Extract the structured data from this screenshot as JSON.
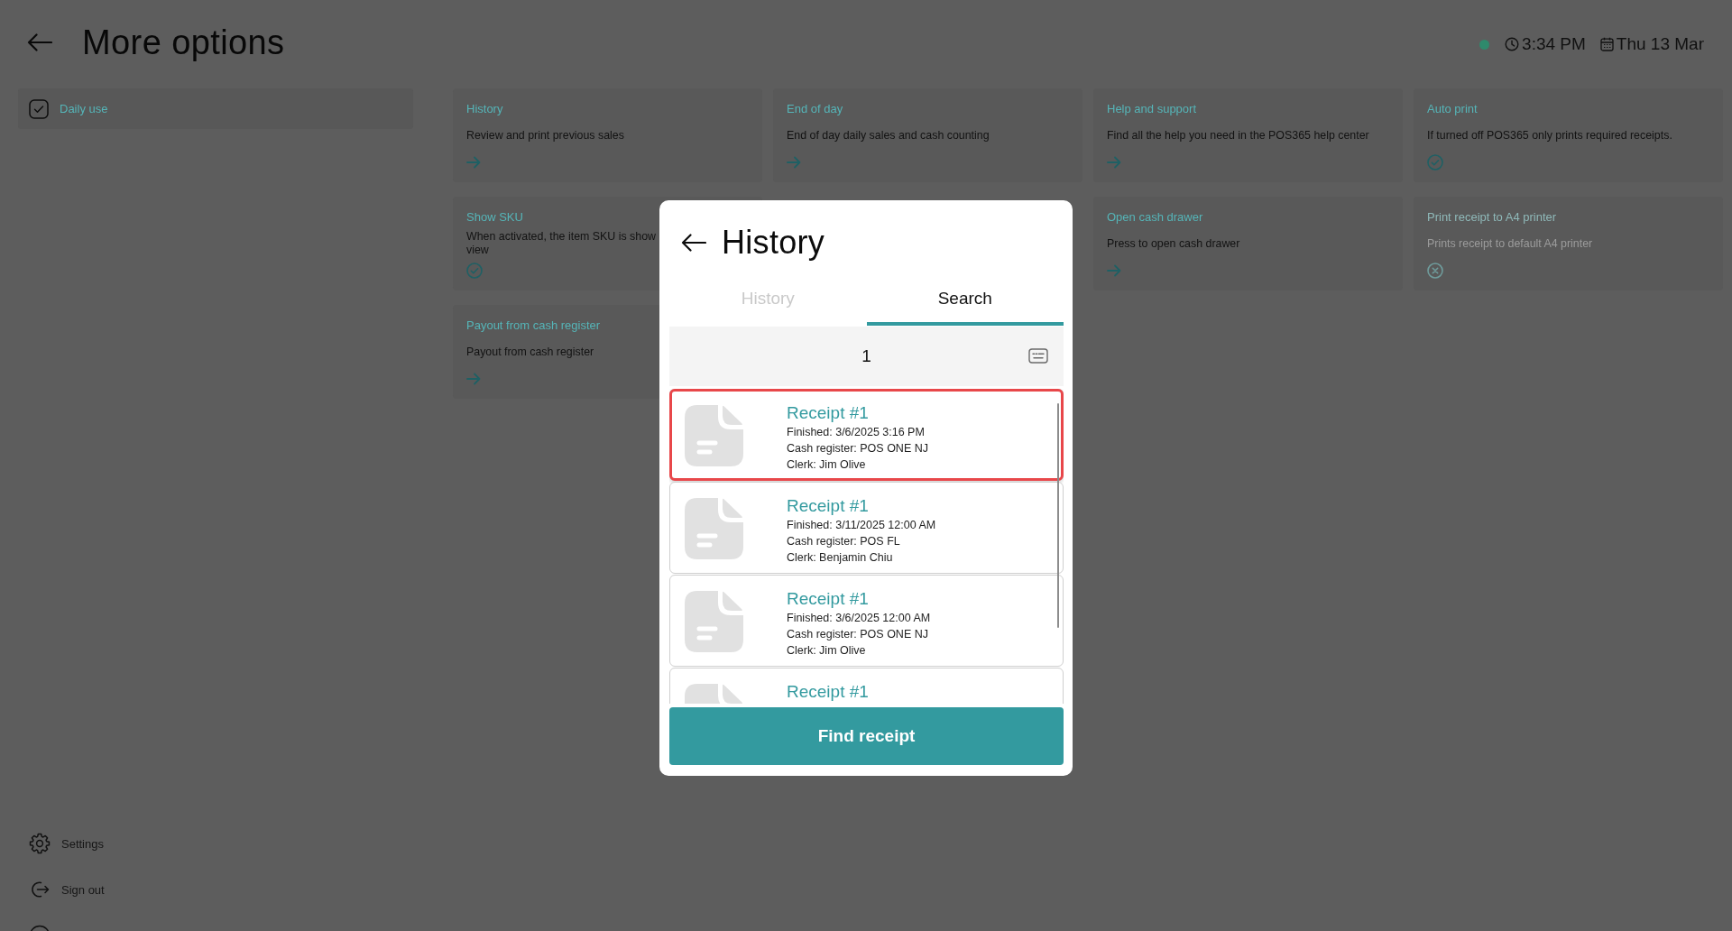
{
  "header": {
    "title": "More options"
  },
  "status": {
    "online": true,
    "time": "3:34 PM",
    "date": "Thu 13 Mar"
  },
  "sidebar": {
    "items": [
      {
        "label": "Daily use",
        "selected": true
      }
    ],
    "footer_items": [
      {
        "kind": "settings",
        "label": "Settings"
      },
      {
        "kind": "signout",
        "label": "Sign out"
      },
      {
        "kind": "other"
      }
    ]
  },
  "option_grid": {
    "columns": [
      {
        "cards": [
          {
            "kind": "link",
            "title": "History",
            "description": "Review and print previous sales",
            "disabled": false
          },
          {
            "kind": "toggle",
            "title": "Show SKU",
            "description": "When activated, the item SKU is show\nview",
            "on": true,
            "disabled": false
          },
          {
            "kind": "link",
            "title": "Payout from cash register",
            "description": "Payout from cash register",
            "disabled": false
          }
        ]
      },
      {
        "cards": [
          {
            "kind": "link",
            "title": "End of day",
            "description": "End of day daily sales and cash counting",
            "disabled": false
          }
        ]
      },
      {
        "cards": [
          {
            "kind": "link",
            "title": "Help and support",
            "description": "Find all the help you need in the POS365 help center",
            "disabled": false
          },
          {
            "kind": "link",
            "title": "Open cash drawer",
            "description": "Press to open cash drawer",
            "disabled": false
          }
        ]
      },
      {
        "cards": [
          {
            "kind": "toggle",
            "title": "Auto print",
            "description": "If turned off POS365 only prints required receipts.",
            "on": true,
            "disabled": false
          },
          {
            "kind": "toggle",
            "title": "Print receipt to A4 printer",
            "description": "Prints receipt to default A4 printer",
            "on": false,
            "disabled": true
          }
        ]
      }
    ]
  },
  "history_dialog": {
    "title": "History",
    "tabs": [
      {
        "label": "History",
        "selected": false
      },
      {
        "label": "Search",
        "selected": true
      }
    ],
    "search": {
      "value": "1"
    },
    "receipts": [
      {
        "title": "Receipt #1",
        "finished": "Finished: 3/6/2025 3:16 PM",
        "cash_register": "Cash register: POS ONE NJ",
        "clerk": "Clerk: Jim Olive",
        "highlighted": true
      },
      {
        "title": "Receipt #1",
        "finished": "Finished: 3/11/2025 12:00 AM",
        "cash_register": "Cash register: POS FL",
        "clerk": "Clerk: Benjamin Chiu",
        "highlighted": false
      },
      {
        "title": "Receipt #1",
        "finished": "Finished: 3/6/2025 12:00 AM",
        "cash_register": "Cash register: POS ONE NJ",
        "clerk": "Clerk: Jim Olive",
        "highlighted": false
      },
      {
        "title": "Receipt #1",
        "highlighted": false
      }
    ],
    "button": "Find receipt"
  }
}
